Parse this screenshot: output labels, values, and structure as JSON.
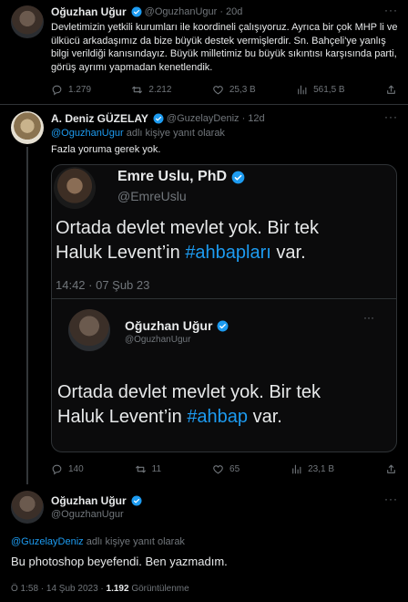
{
  "tweet1": {
    "name": "Oğuzhan Uğur",
    "handle": "@OguzhanUgur",
    "dot": "·",
    "time": "20d",
    "text": "Devletimizin yetkili kurumları ile koordineli çalışıyoruz. Ayrıca bir çok MHP li ve ülkücü arkadaşımız da bize büyük destek vermişlerdir. Sn. Bahçeli'ye yanlış bilgi verildiği kanısındayız. Büyük milletimiz bu büyük sıkıntısı karşısında parti, görüş ayrımı yapmadan kenetlendik.",
    "replies": "1.279",
    "retweets": "2.212",
    "likes": "25,3 B",
    "views": "561,5 B"
  },
  "tweet2": {
    "name": "A. Deniz GÜZELAY",
    "handle": "@GuzelayDeniz",
    "dot": "·",
    "time": "12d",
    "reply_mention": "@OguzhanUgur",
    "reply_suffix": "adlı kişiye yanıt olarak",
    "text": "Fazla yoruma gerek yok.",
    "replies": "140",
    "retweets": "11",
    "likes": "65",
    "views": "23,1 B",
    "image": {
      "top_name": "Emre Uslu, PhD",
      "top_handle": "@EmreUslu",
      "top_text_line1": "Ortada devlet mevlet yok. Bir tek",
      "top_text_line2_pre": "Haluk Levent’in",
      "top_text_link": "#ahbapları",
      "top_text_line2_post": "var.",
      "top_time": "14:42 · 07 Şub 23",
      "inner_name": "Oğuzhan Uğur",
      "inner_handle": "@OguzhanUgur",
      "inner_text_line1": "Ortada devlet mevlet yok. Bir tek",
      "inner_text_line2_pre": "Haluk Levent’in",
      "inner_text_link": "#ahbap",
      "inner_text_line2_post": "var."
    }
  },
  "tweet3": {
    "name": "Oğuzhan Uğur",
    "handle": "@OguzhanUgur",
    "reply_mention": "@GuzelayDeniz",
    "reply_suffix": "adlı kişiye yanıt olarak",
    "text": "Bu photoshop beyefendi. Ben yazmadım.",
    "timestamp": "1:58 PM · 14 Şub 2023",
    "timestamp_display": "Ö 1:58 · 14 Şub 2023 ·",
    "views_count": "1.192",
    "views_label": "Görüntülenme"
  },
  "colors": {
    "accent": "#1d9bf0",
    "muted": "#71767b",
    "divider": "#2f3336"
  },
  "icons": [
    "verified-badge-icon",
    "reply-icon",
    "retweet-icon",
    "like-icon",
    "views-icon",
    "share-icon",
    "more-icon"
  ]
}
